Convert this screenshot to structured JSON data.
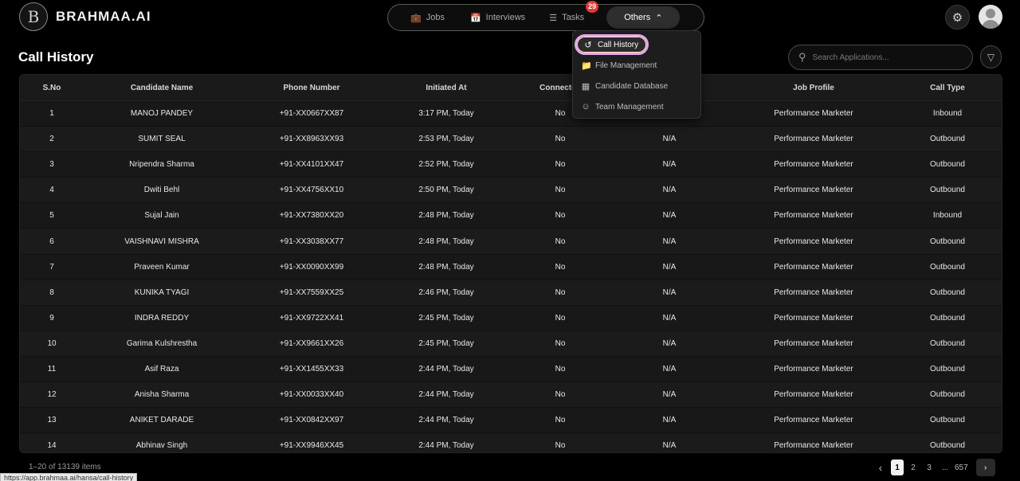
{
  "brand": {
    "mark": "B",
    "name": "BRAHMAA.AI"
  },
  "nav": {
    "jobs": {
      "label": "Jobs",
      "icon": "briefcase-icon"
    },
    "interviews": {
      "label": "Interviews",
      "icon": "calendar-icon"
    },
    "tasks": {
      "label": "Tasks",
      "icon": "list-icon",
      "badge": "29"
    },
    "others": {
      "label": "Others",
      "icon": "chevron-up-icon"
    }
  },
  "dropdown": [
    {
      "label": "Call History",
      "icon": "history-icon",
      "active": true
    },
    {
      "label": "File Management",
      "icon": "folder-icon"
    },
    {
      "label": "Candidate Database",
      "icon": "database-icon"
    },
    {
      "label": "Team Management",
      "icon": "users-icon"
    }
  ],
  "page": {
    "title": "Call History"
  },
  "search": {
    "placeholder": "Search Applications..."
  },
  "table": {
    "headers": [
      "S.No",
      "Candidate Name",
      "Phone Number",
      "Initiated At",
      "Connected",
      "",
      "Job Profile",
      "Call Type"
    ],
    "rows": [
      [
        "1",
        "MANOJ PANDEY",
        "+91-XX0667XX87",
        "3:17 PM, Today",
        "No",
        "",
        "Performance Marketer",
        "Inbound"
      ],
      [
        "2",
        "SUMIT SEAL",
        "+91-XX8963XX93",
        "2:53 PM, Today",
        "No",
        "N/A",
        "Performance Marketer",
        "Outbound"
      ],
      [
        "3",
        "Nripendra Sharma",
        "+91-XX4101XX47",
        "2:52 PM, Today",
        "No",
        "N/A",
        "Performance Marketer",
        "Outbound"
      ],
      [
        "4",
        "Dwiti Behl",
        "+91-XX4756XX10",
        "2:50 PM, Today",
        "No",
        "N/A",
        "Performance Marketer",
        "Outbound"
      ],
      [
        "5",
        "Sujal Jain",
        "+91-XX7380XX20",
        "2:48 PM, Today",
        "No",
        "N/A",
        "Performance Marketer",
        "Inbound"
      ],
      [
        "6",
        "VAISHNAVI MISHRA",
        "+91-XX3038XX77",
        "2:48 PM, Today",
        "No",
        "N/A",
        "Performance Marketer",
        "Outbound"
      ],
      [
        "7",
        "Praveen Kumar",
        "+91-XX0090XX99",
        "2:48 PM, Today",
        "No",
        "N/A",
        "Performance Marketer",
        "Outbound"
      ],
      [
        "8",
        "KUNIKA TYAGI",
        "+91-XX7559XX25",
        "2:46 PM, Today",
        "No",
        "N/A",
        "Performance Marketer",
        "Outbound"
      ],
      [
        "9",
        "INDRA REDDY",
        "+91-XX9722XX41",
        "2:45 PM, Today",
        "No",
        "N/A",
        "Performance Marketer",
        "Outbound"
      ],
      [
        "10",
        "Garima Kulshrestha",
        "+91-XX9661XX26",
        "2:45 PM, Today",
        "No",
        "N/A",
        "Performance Marketer",
        "Outbound"
      ],
      [
        "11",
        "Asif Raza",
        "+91-XX1455XX33",
        "2:44 PM, Today",
        "No",
        "N/A",
        "Performance Marketer",
        "Outbound"
      ],
      [
        "12",
        "Anisha Sharma",
        "+91-XX0033XX40",
        "2:44 PM, Today",
        "No",
        "N/A",
        "Performance Marketer",
        "Outbound"
      ],
      [
        "13",
        "ANIKET DARADE",
        "+91-XX0842XX97",
        "2:44 PM, Today",
        "No",
        "N/A",
        "Performance Marketer",
        "Outbound"
      ],
      [
        "14",
        "Abhinav Singh",
        "+91-XX9946XX45",
        "2:44 PM, Today",
        "No",
        "N/A",
        "Performance Marketer",
        "Outbound"
      ]
    ]
  },
  "footer": {
    "items_count": "1–20 of 13139 items",
    "pages": [
      "1",
      "2",
      "3",
      "...",
      "657"
    ],
    "current_page": "1"
  },
  "status_bar": {
    "url": "https://app.brahmaa.ai/hansa/call-history"
  },
  "colors": {
    "accent_ring": "#e8a5ee",
    "badge": "#e53935",
    "background": "#000000"
  }
}
